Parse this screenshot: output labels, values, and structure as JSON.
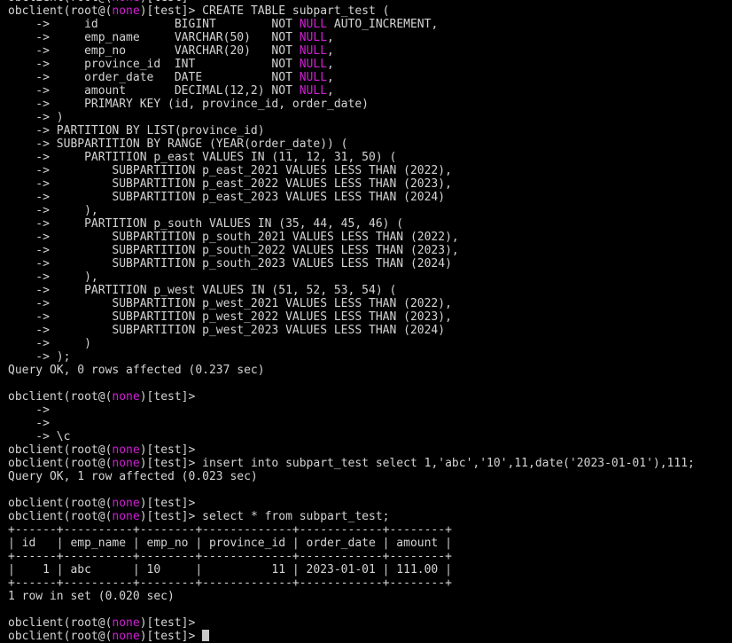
{
  "theme": {
    "background": "#000000",
    "foreground": "#d4d4d4",
    "highlight": "#d11fd6"
  },
  "terminal": {
    "lines": [
      [
        {
          "t": "obclient(root@("
        },
        {
          "t": "none",
          "hl": true
        },
        {
          "t": ")[test]>"
        }
      ],
      [
        {
          "t": "obclient(root@("
        },
        {
          "t": "none",
          "hl": true
        },
        {
          "t": ")[test]> CREATE TABLE subpart_test ("
        }
      ],
      [
        {
          "t": "    ->     id           BIGINT        NOT "
        },
        {
          "t": "NULL",
          "hl": true
        },
        {
          "t": " AUTO_INCREMENT,"
        }
      ],
      [
        {
          "t": "    ->     emp_name     VARCHAR(50)   NOT "
        },
        {
          "t": "NULL",
          "hl": true
        },
        {
          "t": ","
        }
      ],
      [
        {
          "t": "    ->     emp_no       VARCHAR(20)   NOT "
        },
        {
          "t": "NULL",
          "hl": true
        },
        {
          "t": ","
        }
      ],
      [
        {
          "t": "    ->     province_id  INT           NOT "
        },
        {
          "t": "NULL",
          "hl": true
        },
        {
          "t": ","
        }
      ],
      [
        {
          "t": "    ->     order_date   DATE          NOT "
        },
        {
          "t": "NULL",
          "hl": true
        },
        {
          "t": ","
        }
      ],
      [
        {
          "t": "    ->     amount       DECIMAL(12,2) NOT "
        },
        {
          "t": "NULL",
          "hl": true
        },
        {
          "t": ","
        }
      ],
      [
        {
          "t": "    ->     PRIMARY KEY (id, province_id, order_date)"
        }
      ],
      [
        {
          "t": "    -> )"
        }
      ],
      [
        {
          "t": "    -> PARTITION BY LIST(province_id)"
        }
      ],
      [
        {
          "t": "    -> SUBPARTITION BY RANGE (YEAR(order_date)) ("
        }
      ],
      [
        {
          "t": "    ->     PARTITION p_east VALUES IN (11, 12, 31, 50) ("
        }
      ],
      [
        {
          "t": "    ->         SUBPARTITION p_east_2021 VALUES LESS THAN (2022),"
        }
      ],
      [
        {
          "t": "    ->         SUBPARTITION p_east_2022 VALUES LESS THAN (2023),"
        }
      ],
      [
        {
          "t": "    ->         SUBPARTITION p_east_2023 VALUES LESS THAN (2024)"
        }
      ],
      [
        {
          "t": "    ->     ),"
        }
      ],
      [
        {
          "t": "    ->     PARTITION p_south VALUES IN (35, 44, 45, 46) ("
        }
      ],
      [
        {
          "t": "    ->         SUBPARTITION p_south_2021 VALUES LESS THAN (2022),"
        }
      ],
      [
        {
          "t": "    ->         SUBPARTITION p_south_2022 VALUES LESS THAN (2023),"
        }
      ],
      [
        {
          "t": "    ->         SUBPARTITION p_south_2023 VALUES LESS THAN (2024)"
        }
      ],
      [
        {
          "t": "    ->     ),"
        }
      ],
      [
        {
          "t": "    ->     PARTITION p_west VALUES IN (51, 52, 53, 54) ("
        }
      ],
      [
        {
          "t": "    ->         SUBPARTITION p_west_2021 VALUES LESS THAN (2022),"
        }
      ],
      [
        {
          "t": "    ->         SUBPARTITION p_west_2022 VALUES LESS THAN (2023),"
        }
      ],
      [
        {
          "t": "    ->         SUBPARTITION p_west_2023 VALUES LESS THAN (2024)"
        }
      ],
      [
        {
          "t": "    ->     )"
        }
      ],
      [
        {
          "t": "    -> );"
        }
      ],
      [
        {
          "t": "Query OK, 0 rows affected (0.237 sec)"
        }
      ],
      [],
      [
        {
          "t": "obclient(root@("
        },
        {
          "t": "none",
          "hl": true
        },
        {
          "t": ")[test]>"
        }
      ],
      [
        {
          "t": "    ->"
        }
      ],
      [
        {
          "t": "    ->"
        }
      ],
      [
        {
          "t": "    -> \\c"
        }
      ],
      [
        {
          "t": "obclient(root@("
        },
        {
          "t": "none",
          "hl": true
        },
        {
          "t": ")[test]>"
        }
      ],
      [
        {
          "t": "obclient(root@("
        },
        {
          "t": "none",
          "hl": true
        },
        {
          "t": ")[test]> insert into subpart_test select 1,'abc','10',11,date('2023-01-01'),111;"
        }
      ],
      [
        {
          "t": "Query OK, 1 row affected (0.023 sec)"
        }
      ],
      [],
      [
        {
          "t": "obclient(root@("
        },
        {
          "t": "none",
          "hl": true
        },
        {
          "t": ")[test]>"
        }
      ],
      [
        {
          "t": "obclient(root@("
        },
        {
          "t": "none",
          "hl": true
        },
        {
          "t": ")[test]> select * from subpart_test;"
        }
      ],
      [
        {
          "t": "+------+----------+--------+-------------+------------+--------+"
        }
      ],
      [
        {
          "t": "| id   | emp_name | emp_no | province_id | order_date | amount |"
        }
      ],
      [
        {
          "t": "+------+----------+--------+-------------+------------+--------+"
        }
      ],
      [
        {
          "t": "|    1 | abc      | 10     |          11 | 2023-01-01 | 111.00 |"
        }
      ],
      [
        {
          "t": "+------+----------+--------+-------------+------------+--------+"
        }
      ],
      [
        {
          "t": "1 row in set (0.020 sec)"
        }
      ],
      [],
      [
        {
          "t": "obclient(root@("
        },
        {
          "t": "none",
          "hl": true
        },
        {
          "t": ")[test]>"
        }
      ],
      [
        {
          "t": "obclient(root@("
        },
        {
          "t": "none",
          "hl": true
        },
        {
          "t": ")[test]> "
        }
      ]
    ]
  }
}
